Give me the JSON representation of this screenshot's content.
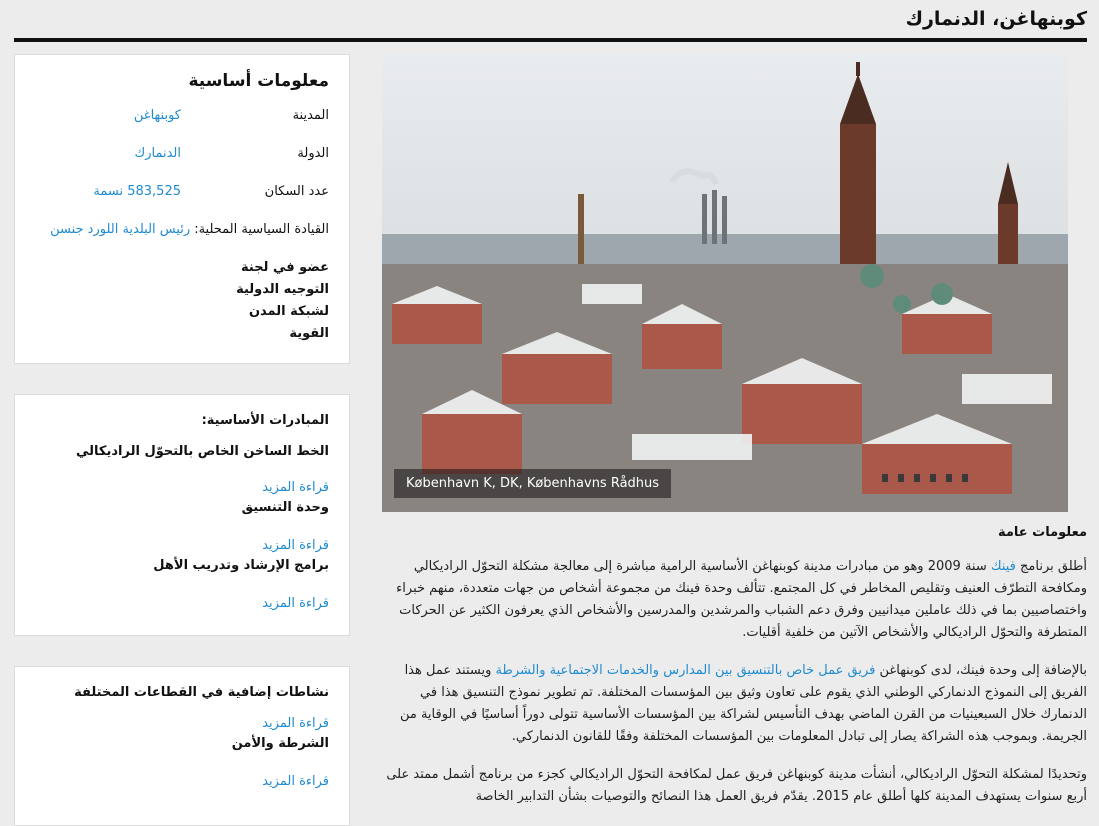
{
  "page": {
    "title": "كوبنهاغن، الدنمارك"
  },
  "basic_info": {
    "heading": "معلومات أساسية",
    "rows": [
      {
        "key": "المدينة",
        "value": "كوبنهاغن"
      },
      {
        "key": "الدولة",
        "value": "الدنمارك"
      },
      {
        "key": "عدد السكان",
        "value": "583,525 نسمة"
      },
      {
        "key": "القيادة السياسية المحلية:",
        "value": "رئيس البلدية اللورد جنسن"
      }
    ],
    "membership": "عضو في لجنة التوجيه الدولية لشبكة المدن القوية"
  },
  "initiatives": {
    "heading": "المبادرات الأساسية:",
    "items": [
      {
        "title": "الخط الساخن الخاص بالتحوّل الراديكالي",
        "more": "قراءة المزيد"
      },
      {
        "title": "وحدة التنسيق",
        "more": "قراءة المزيد"
      },
      {
        "title": "برامج الإرشاد وتدريب الأهل",
        "more": "قراءة المزيد"
      }
    ]
  },
  "extra": {
    "heading": "نشاطات إضافية في القطاعات المختلفة",
    "items": [
      {
        "title": "الشرطة والأمن",
        "more": "قراءة المزيد"
      }
    ],
    "more_first": "قراءة المزيد",
    "more_last": "قراءة المزيد"
  },
  "photo": {
    "caption": "København K, DK, Københavns Rådhus"
  },
  "general": {
    "heading": "معلومات عامة",
    "p1_a": "أطلق برنامج ",
    "p1_link": "فينك",
    "p1_b": " سنة 2009 وهو من مبادرات مدينة كوبنهاغن الأساسية الرامية مباشرة إلى معالجة مشكلة التحوّل الراديكالي ومكافحة التطرّف العنيف وتقليص المخاطر في كل المجتمع.  تتألف وحدة فينك من مجموعة أشخاص من جهات متعددة، منهم خبراء واختصاصيين بما في ذلك عاملين ميدانيين وفرق دعم الشباب والمرشدين والمدرسين والأشخاص الذي يعرفون الكثير عن الحركات المتطرفة والتحوّل الراديكالي والأشخاص الآتين من خلفية أقليات.",
    "p2_a": "بالإضافة إلى وحدة فينك، لدى كوبنهاغن ",
    "p2_link": "فريق عمل خاص بالتنسيق بين المدارس والخدمات الاجتماعية والشرطة",
    "p2_b": " ويستند عمل هذا الفريق  إلى النموذج الدنماركي الوطني الذي يقوم على تعاون وثيق بين المؤسسات المختلفة. تم تطوير نموذج التنسيق هذا في الدنمارك خلال السبعينيات من القرن الماضي بهدف التأسيس لشراكة بين المؤسسات الأساسية تتولى دوراً أساسيًا في الوقاية من الجريمة. وبموجب هذه الشراكة يصار إلى تبادل المعلومات بين المؤسسات المختلفة وفقًا للقانون الدنماركي.",
    "p3": "وتحديدًا لمشكلة التحوّل الراديكالي، أنشأت مدينة كوبنهاغن فريق عمل لمكافحة التحوّل الراديكالي كجزء من برنامج أشمل ممتد على أربع سنوات يستهدف المدينة كلها أطلق عام 2015. يقدّم فريق العمل هذا النصائح والتوصيات بشأن التدابير الخاصة"
  },
  "colors": {
    "link": "#1f8bd1",
    "rule": "#111111",
    "background": "#ececec"
  }
}
